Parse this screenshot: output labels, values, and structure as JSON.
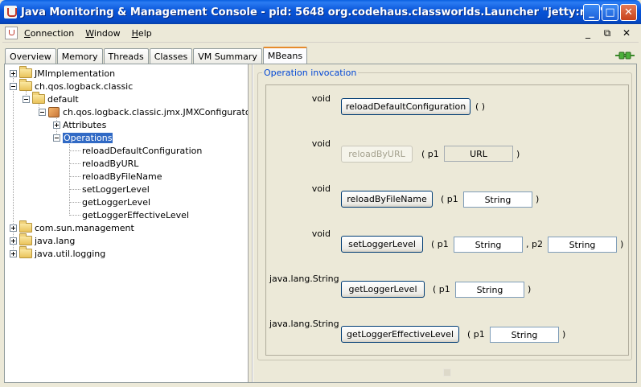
{
  "window": {
    "title": "Java Monitoring & Management Console - pid: 5648 org.codehaus.classworlds.Launcher \"jetty:run\"",
    "minimize": "_",
    "maximize": "□",
    "close": "✕"
  },
  "menubar": {
    "items": [
      {
        "u": "C",
        "rest": "onnection"
      },
      {
        "u": "W",
        "rest": "indow"
      },
      {
        "u": "H",
        "rest": "elp"
      }
    ],
    "mdi_min": "_",
    "mdi_restore": "⧉",
    "mdi_close": "✕"
  },
  "tabs": [
    "Overview",
    "Memory",
    "Threads",
    "Classes",
    "VM Summary",
    "MBeans"
  ],
  "tree": {
    "jmimpl": "JMImplementation",
    "logback": "ch.qos.logback.classic",
    "default": "default",
    "configurator": "ch.qos.logback.classic.jmx.JMXConfigurator",
    "attributes": "Attributes",
    "operations": "Operations",
    "ops": [
      "reloadDefaultConfiguration",
      "reloadByURL",
      "reloadByFileName",
      "setLoggerLevel",
      "getLoggerLevel",
      "getLoggerEffectiveLevel"
    ],
    "sun_mgmt": "com.sun.management",
    "java_lang": "java.lang",
    "java_util_logging": "java.util.logging"
  },
  "invocation": {
    "title": "Operation invocation",
    "ops": [
      {
        "ret": "void",
        "name": "reloadDefaultConfiguration",
        "tail": "( )"
      },
      {
        "ret": "void",
        "name": "reloadByURL",
        "open": "( p1",
        "p1": "URL",
        "close": ")"
      },
      {
        "ret": "void",
        "name": "reloadByFileName",
        "open": "( p1",
        "p1": "String",
        "close": ")"
      },
      {
        "ret": "void",
        "name": "setLoggerLevel",
        "open": "( p1",
        "p1": "String",
        "mid": ", p2",
        "p2": "String",
        "close": ")"
      },
      {
        "ret": "java.lang.String",
        "name": "getLoggerLevel",
        "open": "( p1",
        "p1": "String",
        "close": ")"
      },
      {
        "ret": "java.lang.String",
        "name": "getLoggerEffectiveLevel",
        "open": "( p1",
        "p1": "String",
        "close": ")"
      }
    ]
  }
}
